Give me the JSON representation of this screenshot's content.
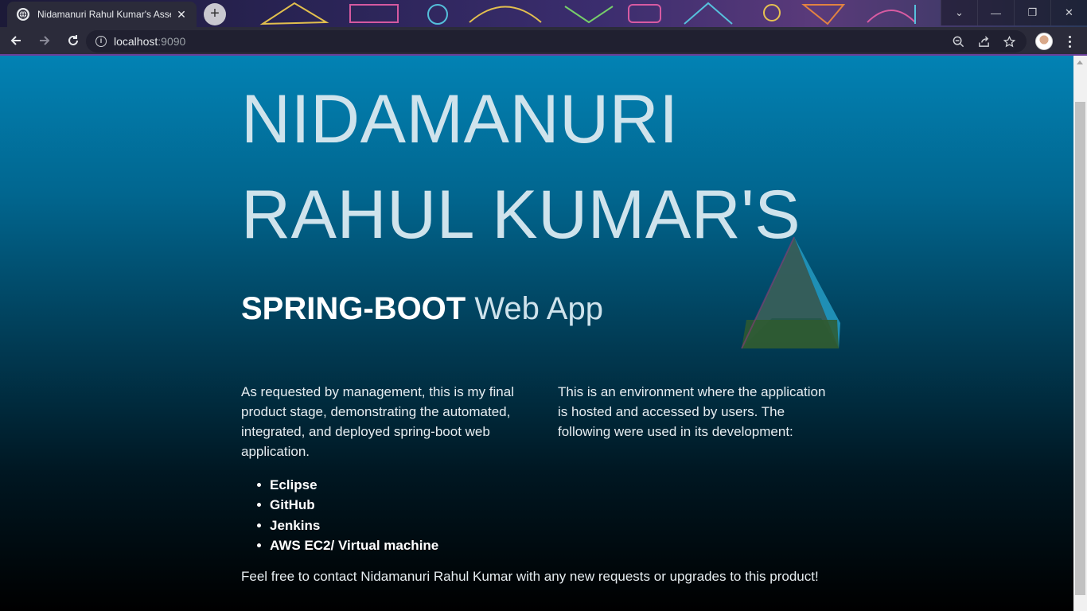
{
  "browser": {
    "tab_title": "Nidamanuri Rahul Kumar's Assessment",
    "url_host": "localhost",
    "url_port": ":9090",
    "new_tab_label": "+",
    "close_tab_label": "✕",
    "window_controls": [
      "⌄",
      "—",
      "❐",
      "✕"
    ]
  },
  "page": {
    "title_line1": "NIDAMANURI",
    "title_line2": "RAHUL KUMAR'S",
    "subtitle_bold": "SPRING-BOOT",
    "subtitle_rest": " Web App",
    "intro_left": "As requested by management, this is my final product stage, demonstrating the automated, integrated, and deployed spring-boot web application.",
    "intro_right": "This is an environment where the application is hosted and accessed by users. The following were used in its development:",
    "tools": [
      "Eclipse",
      "GitHub",
      "Jenkins",
      "AWS EC2/ Virtual machine"
    ],
    "contact": "Feel free to contact Nidamanuri Rahul Kumar with any new requests or upgrades to this product!"
  },
  "colors": {
    "gradient_top": "#0282b4",
    "gradient_bottom": "#000000",
    "tab_bg": "#2b2b3a",
    "accent_border": "#6b3f9a"
  }
}
